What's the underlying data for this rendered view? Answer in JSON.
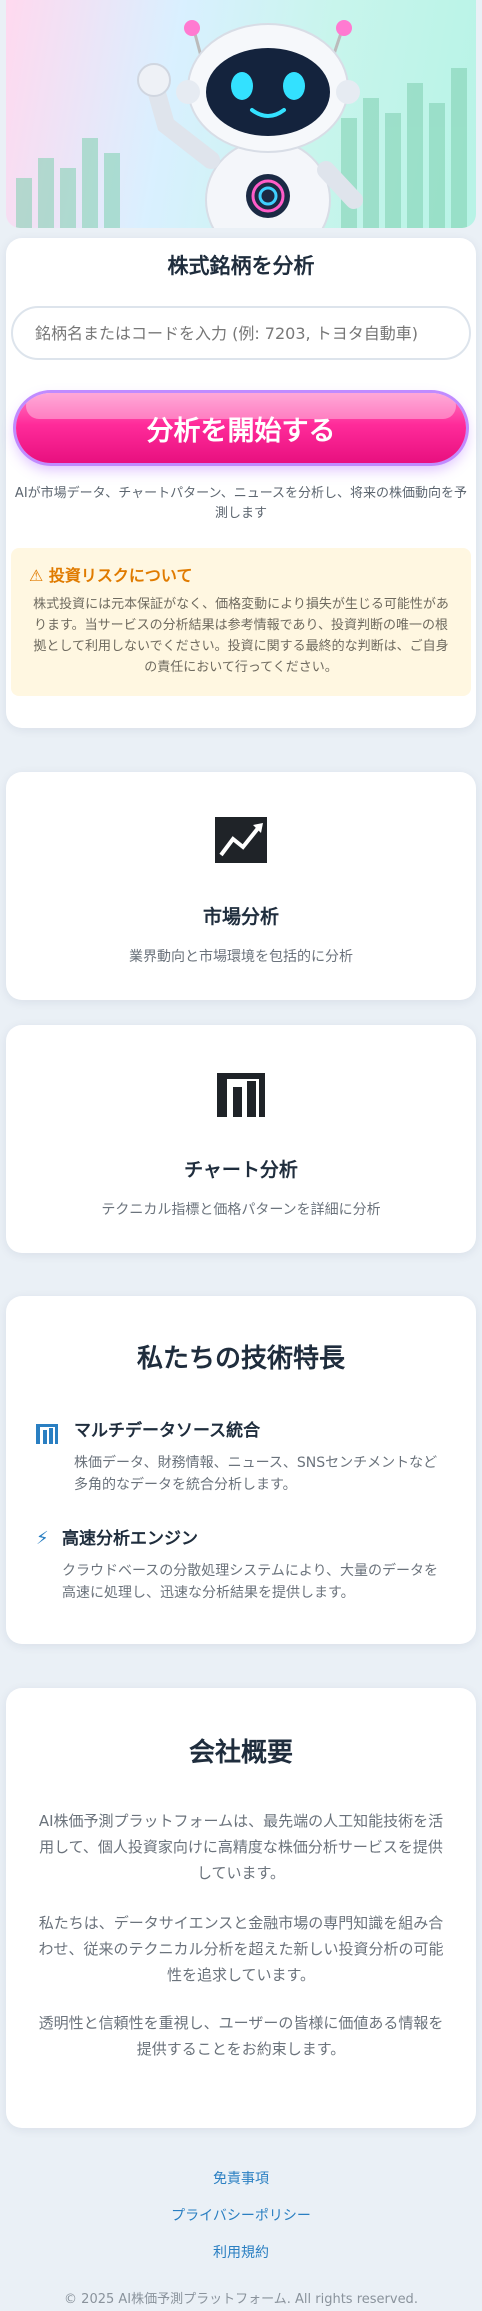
{
  "analysis": {
    "title": "株式銘柄を分析",
    "search_placeholder": "銘柄名またはコードを入力 (例: 7203, トヨタ自動車)",
    "search_value": "",
    "button_label": "分析を開始する",
    "description": "AIが市場データ、チャートパターン、ニュースを分析し、将来の株価動向を予測します",
    "risk_title": "投資リスクについて",
    "risk_text": "株式投資には元本保証がなく、価格変動により損失が生じる可能性があります。当サービスの分析結果は参考情報であり、投資判断の唯一の根拠として利用しないでください。投資に関する最終的な判断は、ご自身の責任において行ってください。"
  },
  "features": [
    {
      "icon": "chart-line-icon",
      "title": "市場分析",
      "description": "業界動向と市場環境を包括的に分析"
    },
    {
      "icon": "bar-chart-icon",
      "title": "チャート分析",
      "description": "テクニカル指標と価格パターンを詳細に分析"
    }
  ],
  "tech": {
    "title": "私たちの技術特長",
    "items": [
      {
        "icon": "bar-chart-icon",
        "title": "マルチデータソース統合",
        "description": "株価データ、財務情報、ニュース、SNSセンチメントなど多角的なデータを統合分析します。"
      },
      {
        "icon": "lightning-icon",
        "title": "高速分析エンジン",
        "description": "クラウドベースの分散処理システムにより、大量のデータを高速に処理し、迅速な分析結果を提供します。"
      }
    ]
  },
  "company": {
    "title": "会社概要",
    "paragraphs": [
      "AI株価予測プラットフォームは、最先端の人工知能技術を活用して、個人投資家向けに高精度な株価分析サービスを提供しています。",
      "私たちは、データサイエンスと金融市場の専門知識を組み合わせ、従来のテクニカル分析を超えた新しい投資分析の可能性を追求しています。",
      "透明性と信頼性を重視し、ユーザーの皆様に価値ある情報を提供することをお約束します。"
    ]
  },
  "footer": {
    "links": [
      "免責事項",
      "プライバシーポリシー",
      "利用規約"
    ],
    "copyright": "© 2025 AI株価予測プラットフォーム. All rights reserved."
  },
  "colors": {
    "accent": "#ff2b9a",
    "link": "#2a7fc2",
    "warning": "#e07b00",
    "warning_bg": "#fff7e1"
  }
}
